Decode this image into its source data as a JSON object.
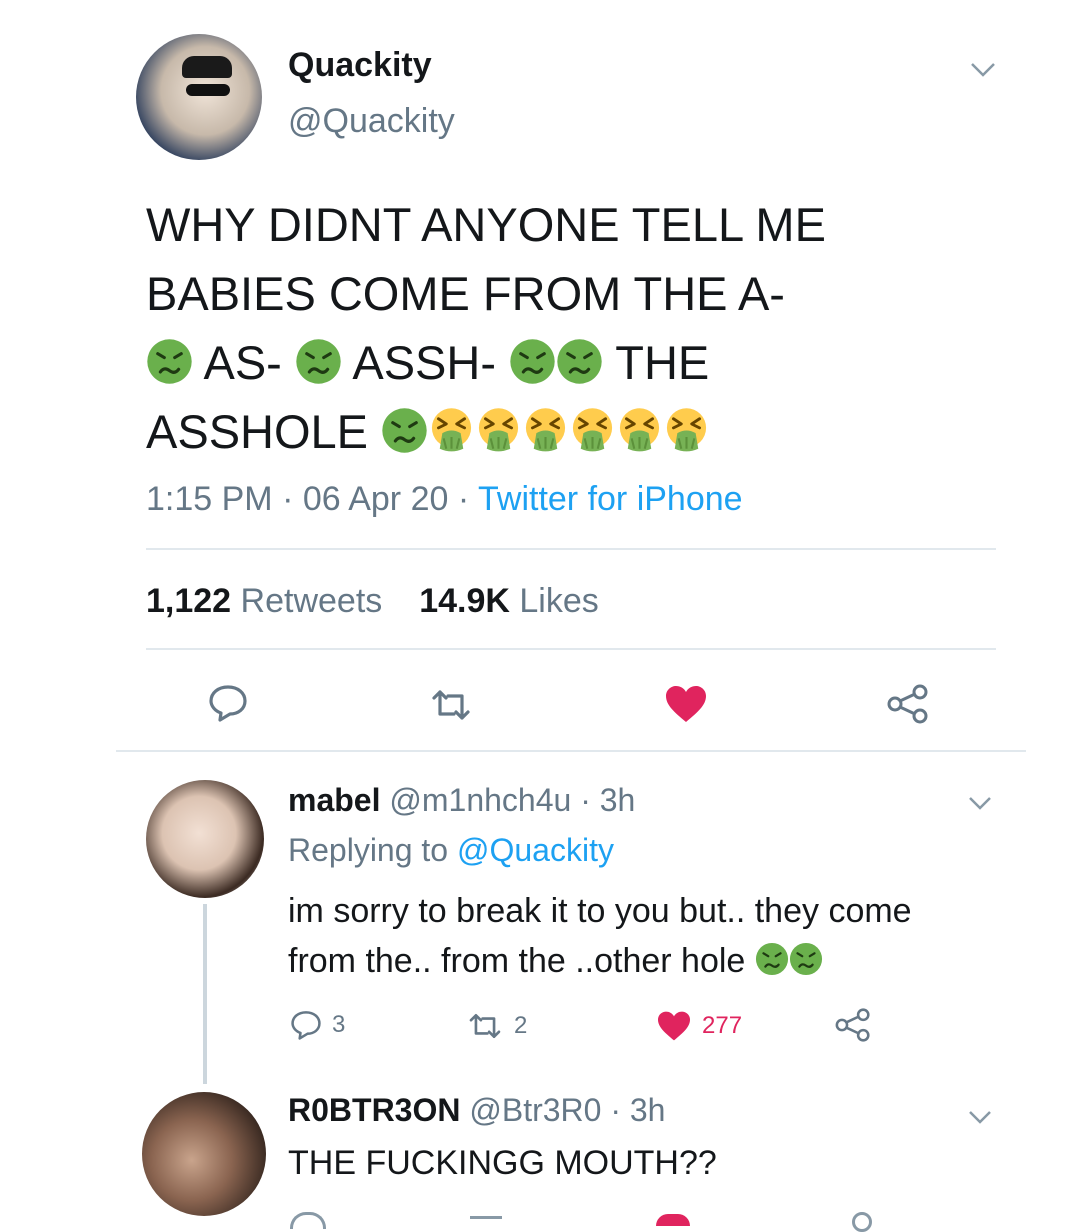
{
  "main_tweet": {
    "name": "Quackity",
    "handle": "@Quackity",
    "line1": "WHY DIDNT ANYONE TELL ME",
    "line2": "BABIES COME FROM THE A-",
    "seg_as": "AS-",
    "seg_assh": "ASSH-",
    "seg_the": "THE",
    "seg_asshole": "ASSHOLE",
    "time": "1:15 PM · 06 Apr 20 · ",
    "source": "Twitter for iPhone",
    "retweets_count": "1,122",
    "retweets_label": "Retweets",
    "likes_count": "14.9K",
    "likes_label": "Likes"
  },
  "reply1": {
    "name": "mabel",
    "handle_time": "@m1nhch4u · 3h",
    "replying_prefix": "Replying to ",
    "replying_to": "@Quackity",
    "text_line1": "im sorry to break it to you but.. they come",
    "text_line2": "from the.. from the ..other hole",
    "replies": "3",
    "retweets": "2",
    "likes": "277"
  },
  "reply2": {
    "name": "R0BTR3ON",
    "handle_time": "@Btr3R0 · 3h",
    "text": "THE FUCKINGG MOUTH??"
  },
  "colors": {
    "like_red": "#e0245e",
    "link_blue": "#1da1f2",
    "gray_text": "#657786",
    "sick_green": "#6ab04c",
    "vomit_yellow": "#ffcc4d"
  },
  "icons": [
    "chevron-down-icon",
    "reply-icon",
    "retweet-icon",
    "heart-icon",
    "share-icon",
    "nauseated-face-emoji",
    "vomiting-face-emoji"
  ]
}
